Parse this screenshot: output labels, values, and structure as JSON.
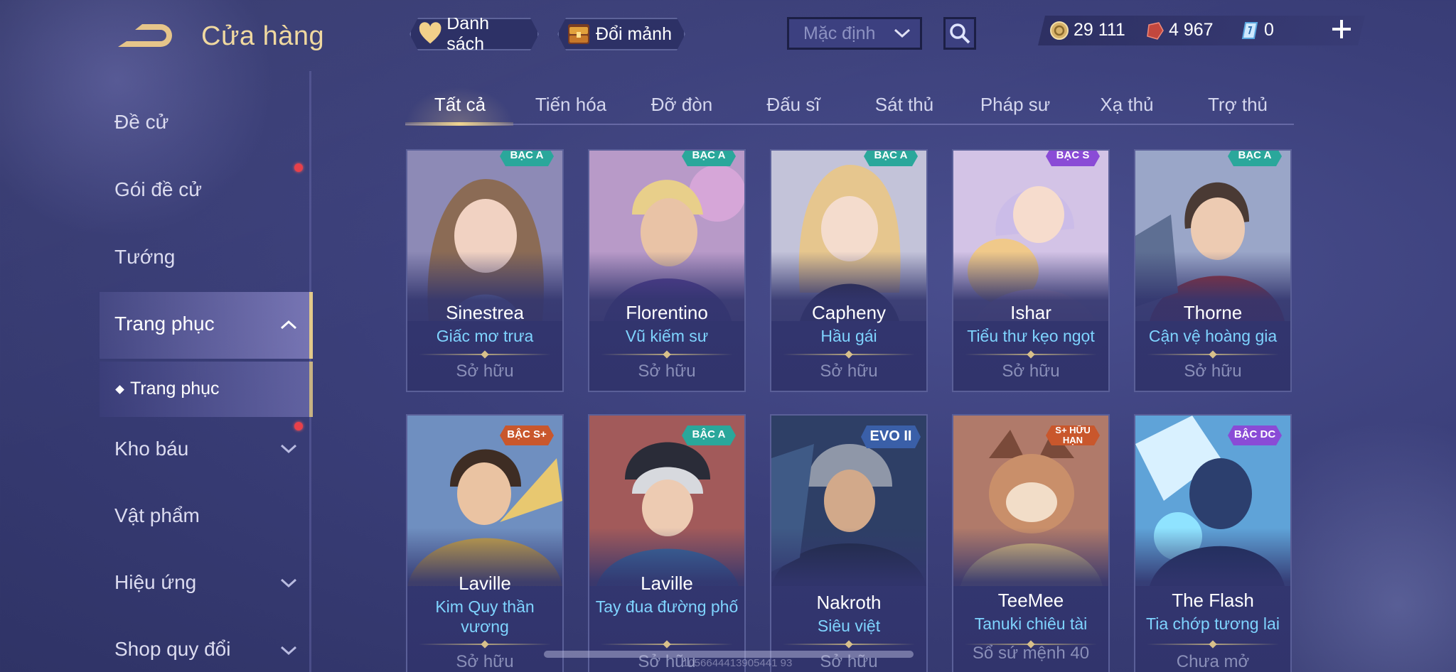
{
  "header": {
    "title": "Cửa hàng",
    "list_button": "Danh sách",
    "exchange_button": "Đổi mảnh",
    "sort_value": "Mặc định",
    "currencies": {
      "gold": "29 111",
      "ruby": "4 967",
      "voucher": "0"
    }
  },
  "sidebar": {
    "items": [
      {
        "label": "Đề cử"
      },
      {
        "label": "Gói đề cử"
      },
      {
        "label": "Tướng"
      },
      {
        "label": "Trang phục"
      },
      {
        "label": "Trang phục"
      },
      {
        "label": "Kho báu"
      },
      {
        "label": "Vật phẩm"
      },
      {
        "label": "Hiệu ứng"
      },
      {
        "label": "Shop quy đổi"
      }
    ]
  },
  "tabs": [
    {
      "label": "Tất cả"
    },
    {
      "label": "Tiến hóa"
    },
    {
      "label": "Đỡ đòn"
    },
    {
      "label": "Đấu sĩ"
    },
    {
      "label": "Sát thủ"
    },
    {
      "label": "Pháp sư"
    },
    {
      "label": "Xạ thủ"
    },
    {
      "label": "Trợ thủ"
    }
  ],
  "cards": [
    {
      "hero": "Sinestrea",
      "skin": "Giấc mơ trưa",
      "status": "Sở hữu",
      "badge": "BẬC A"
    },
    {
      "hero": "Florentino",
      "skin": "Vũ kiếm sư",
      "status": "Sở hữu",
      "badge": "BẬC A"
    },
    {
      "hero": "Capheny",
      "skin": "Hầu gái",
      "status": "Sở hữu",
      "badge": "BẬC A"
    },
    {
      "hero": "Ishar",
      "skin": "Tiểu thư kẹo ngọt",
      "status": "Sở hữu",
      "badge": "BẬC S"
    },
    {
      "hero": "Thorne",
      "skin": "Cận vệ hoàng gia",
      "status": "Sở hữu",
      "badge": "BẬC A"
    },
    {
      "hero": "Laville",
      "skin": "Kim Quy thần vương",
      "status": "Sở hữu",
      "badge": "BẬC S+"
    },
    {
      "hero": "Laville",
      "skin": "Tay đua đường phố",
      "status": "Sở hữu",
      "badge": "BẬC A"
    },
    {
      "hero": "Nakroth",
      "skin": "Siêu việt",
      "status": "Sở hữu",
      "badge": "EVO II"
    },
    {
      "hero": "TeeMee",
      "skin": "Tanuki chiêu tài",
      "status": "Sổ sứ mệnh 40",
      "badge": "S+ HỮU HẠN"
    },
    {
      "hero": "The Flash",
      "skin": "Tia chớp tương lai",
      "status": "Chưa mở",
      "badge": "BẬC DC"
    }
  ],
  "watermark": "1056644413905441 93",
  "colors": {
    "accent_gold": "#f0d58f",
    "skin_text": "#7fd4ff",
    "badge_a": "#2aa79b",
    "badge_splus": "#c9572c",
    "badge_s": "#8a4bd6"
  }
}
